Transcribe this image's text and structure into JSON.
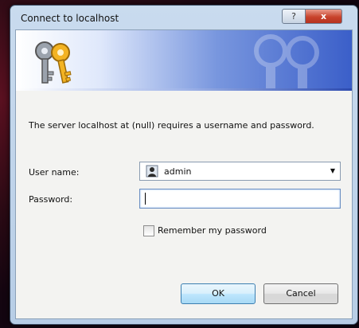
{
  "dialog": {
    "title": "Connect to localhost",
    "help_label": "?",
    "close_label": "x",
    "message": "The server localhost at (null) requires a username and password.",
    "username_label": "User name:",
    "username_value": "admin",
    "password_label": "Password:",
    "password_value": "",
    "remember_label": "Remember my password",
    "remember_checked": false,
    "ok_label": "OK",
    "cancel_label": "Cancel"
  },
  "icons": {
    "banner": "keys-icon",
    "banner_watermark": "keys-watermark-icon",
    "user": "user-icon",
    "dropdown": "dropdown-arrow-icon"
  },
  "colors": {
    "banner_start": "#ffffff",
    "banner_end": "#3b5fc9",
    "close_button": "#c8432c",
    "desktop": "#2a0a14"
  }
}
